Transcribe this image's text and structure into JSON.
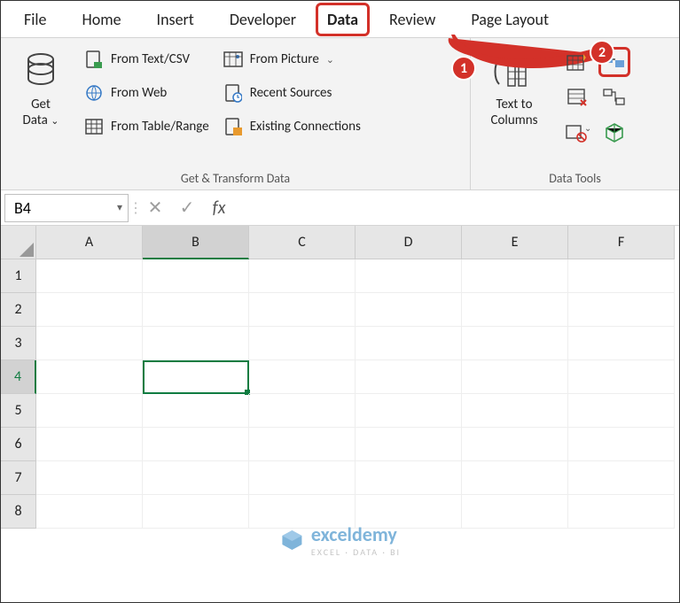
{
  "tabs": {
    "file": "File",
    "home": "Home",
    "insert": "Insert",
    "developer": "Developer",
    "data": "Data",
    "review": "Review",
    "page_layout": "Page Layout"
  },
  "ribbon": {
    "get_transform": {
      "get_data": "Get\nData",
      "from_text_csv": "From Text/CSV",
      "from_web": "From Web",
      "from_table": "From Table/Range",
      "from_picture": "From Picture",
      "recent": "Recent Sources",
      "existing": "Existing Connections",
      "label": "Get & Transform Data"
    },
    "data_tools": {
      "text_to_columns": "Text to\nColumns",
      "label": "Data Tools"
    }
  },
  "formula_bar": {
    "namebox": "B4",
    "cancel_glyph": "✕",
    "enter_glyph": "✓",
    "fx": "fx",
    "value": ""
  },
  "grid": {
    "columns": [
      "A",
      "B",
      "C",
      "D",
      "E",
      "F"
    ],
    "rows": [
      "1",
      "2",
      "3",
      "4",
      "5",
      "6",
      "7",
      "8"
    ],
    "active_col": "B",
    "active_row": "4"
  },
  "annotations": {
    "step1": "1",
    "step2": "2"
  },
  "watermark": {
    "brand": "exceldemy",
    "tag": "EXCEL · DATA · BI"
  }
}
